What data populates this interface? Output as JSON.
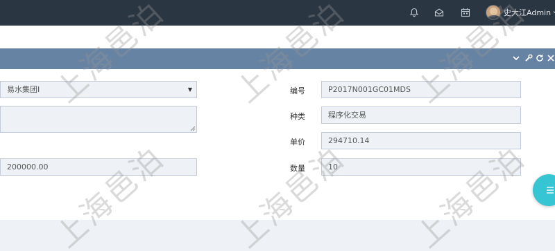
{
  "topbar": {
    "username": "史大江Admin",
    "icons": [
      "bell-icon",
      "envelope-open-icon",
      "calendar-icon",
      "chevron-down-icon"
    ]
  },
  "portlet": {
    "tools": [
      "collapse-icon",
      "wrench-icon",
      "reload-icon",
      "close-icon"
    ]
  },
  "form": {
    "company_value": "易水集团I",
    "amount_value": "200000.00",
    "code_label": "编号",
    "code_value": "P2017N001GC01MDS",
    "type_label": "种类",
    "type_value": "程序化交易",
    "price_label": "单价",
    "price_value": "294710.14",
    "qty_label": "数量",
    "qty_value": "10"
  },
  "watermark": {
    "text": "上海邑泊"
  },
  "colors": {
    "topbar": "#2b3643",
    "portlet_bar": "#6783a3",
    "field_bg": "#eef1f5",
    "fab": "#36c6d3"
  }
}
